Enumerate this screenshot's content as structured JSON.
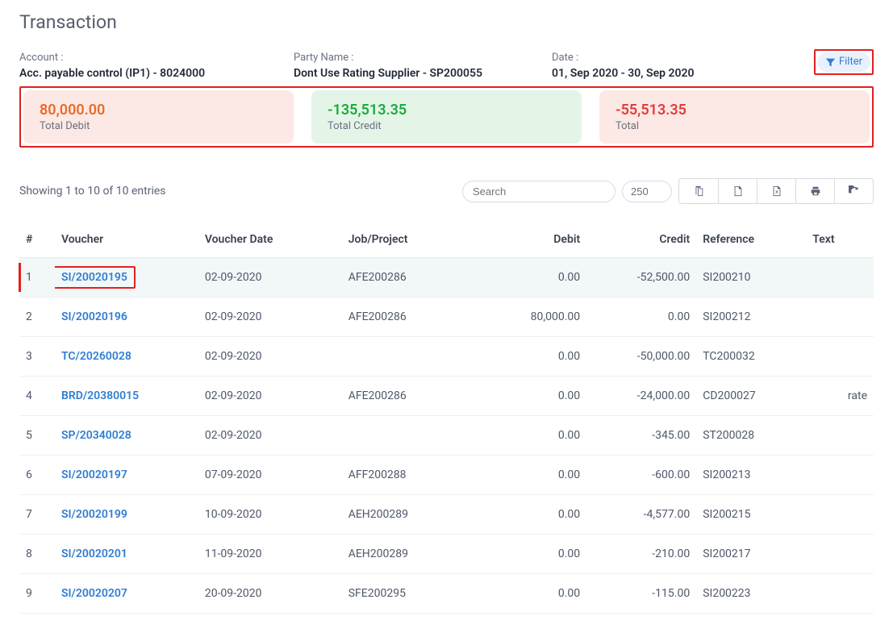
{
  "page_title": "Transaction",
  "info": {
    "account_label": "Account :",
    "account_value": "Acc. payable control (IP1) - 8024000",
    "party_label": "Party Name :",
    "party_value": "Dont Use Rating Supplier - SP200055",
    "date_label": "Date :",
    "date_value": "01, Sep 2020 - 30, Sep 2020"
  },
  "filter_label": "Filter",
  "cards": {
    "debit_amount": "80,000.00",
    "debit_caption": "Total Debit",
    "credit_amount": "-135,513.35",
    "credit_caption": "Total Credit",
    "total_amount": "-55,513.35",
    "total_caption": "Total"
  },
  "showing_text": "Showing 1 to 10 of 10 entries",
  "search_placeholder": "Search",
  "page_size": "250",
  "columns": {
    "idx": "#",
    "voucher": "Voucher",
    "vdate": "Voucher Date",
    "job": "Job/Project",
    "debit": "Debit",
    "credit": "Credit",
    "reference": "Reference",
    "text": "Text"
  },
  "rows": [
    {
      "idx": "1",
      "voucher": "SI/20020195",
      "vdate": "02-09-2020",
      "job": "AFE200286",
      "debit": "0.00",
      "credit": "-52,500.00",
      "reference": "SI200210",
      "text": "",
      "highlight": true
    },
    {
      "idx": "2",
      "voucher": "SI/20020196",
      "vdate": "02-09-2020",
      "job": "AFE200286",
      "debit": "80,000.00",
      "credit": "0.00",
      "reference": "SI200212",
      "text": ""
    },
    {
      "idx": "3",
      "voucher": "TC/20260028",
      "vdate": "02-09-2020",
      "job": "",
      "debit": "0.00",
      "credit": "-50,000.00",
      "reference": "TC200032",
      "text": ""
    },
    {
      "idx": "4",
      "voucher": "BRD/20380015",
      "vdate": "02-09-2020",
      "job": "AFE200286",
      "debit": "0.00",
      "credit": "-24,000.00",
      "reference": "CD200027",
      "text": "rate"
    },
    {
      "idx": "5",
      "voucher": "SP/20340028",
      "vdate": "02-09-2020",
      "job": "",
      "debit": "0.00",
      "credit": "-345.00",
      "reference": "ST200028",
      "text": ""
    },
    {
      "idx": "6",
      "voucher": "SI/20020197",
      "vdate": "07-09-2020",
      "job": "AFF200288",
      "debit": "0.00",
      "credit": "-600.00",
      "reference": "SI200213",
      "text": ""
    },
    {
      "idx": "7",
      "voucher": "SI/20020199",
      "vdate": "10-09-2020",
      "job": "AEH200289",
      "debit": "0.00",
      "credit": "-4,577.00",
      "reference": "SI200215",
      "text": ""
    },
    {
      "idx": "8",
      "voucher": "SI/20020201",
      "vdate": "11-09-2020",
      "job": "AEH200289",
      "debit": "0.00",
      "credit": "-210.00",
      "reference": "SI200217",
      "text": ""
    },
    {
      "idx": "9",
      "voucher": "SI/20020207",
      "vdate": "20-09-2020",
      "job": "SFE200295",
      "debit": "0.00",
      "credit": "-115.00",
      "reference": "SI200223",
      "text": ""
    }
  ]
}
